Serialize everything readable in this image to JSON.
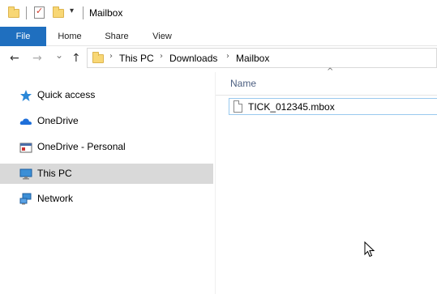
{
  "window": {
    "title": "Mailbox"
  },
  "quick_access": {
    "icons": [
      "folder-icon",
      "properties-icon",
      "new-folder-icon"
    ],
    "dropdown_glyph": "▾"
  },
  "ribbon": {
    "tabs": [
      {
        "label": "File",
        "active": true
      },
      {
        "label": "Home"
      },
      {
        "label": "Share"
      },
      {
        "label": "View"
      }
    ]
  },
  "navigation": {
    "back_glyph": "←",
    "forward_glyph": "→",
    "recent_glyph": "⌄",
    "up_glyph": "↑",
    "breadcrumb": [
      "This PC",
      "Downloads",
      "Mailbox"
    ],
    "separator": "›"
  },
  "nav_pane": {
    "items": [
      {
        "label": "Quick access",
        "icon": "star-icon"
      },
      {
        "label": "OneDrive",
        "icon": "cloud-icon"
      },
      {
        "label": "OneDrive - Personal",
        "icon": "onedrive-personal-icon"
      },
      {
        "label": "This PC",
        "icon": "monitor-icon",
        "selected": true
      },
      {
        "label": "Network",
        "icon": "network-icon"
      }
    ]
  },
  "content": {
    "sort_glyph": "^",
    "column_header": "Name",
    "files": [
      {
        "name": "TICK_012345.mbox",
        "icon": "file-icon"
      }
    ]
  },
  "colors": {
    "file_tab": "#1f6fbf",
    "selected_nav": "#d9d9d9",
    "folder": "#f8d775",
    "column_header_text": "#4d6082",
    "focus_border": "#99c9ef"
  }
}
